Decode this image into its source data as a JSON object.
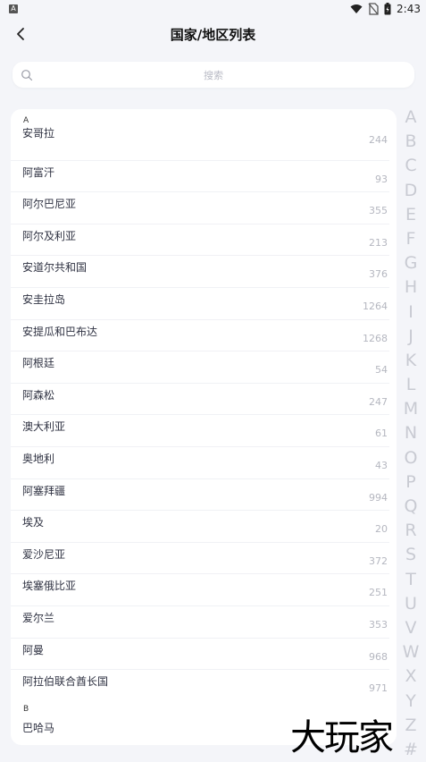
{
  "status_bar": {
    "app_icon_letter": "A",
    "time": "2:43"
  },
  "header": {
    "title": "国家/地区列表"
  },
  "search": {
    "placeholder": "搜索"
  },
  "sections": [
    {
      "letter": "A",
      "items": [
        {
          "name": "安哥拉",
          "code": "244"
        },
        {
          "name": "阿富汗",
          "code": "93"
        },
        {
          "name": "阿尔巴尼亚",
          "code": "355"
        },
        {
          "name": "阿尔及利亚",
          "code": "213"
        },
        {
          "name": "安道尔共和国",
          "code": "376"
        },
        {
          "name": "安圭拉岛",
          "code": "1264"
        },
        {
          "name": "安提瓜和巴布达",
          "code": "1268"
        },
        {
          "name": "阿根廷",
          "code": "54"
        },
        {
          "name": "阿森松",
          "code": "247"
        },
        {
          "name": "澳大利亚",
          "code": "61"
        },
        {
          "name": "奥地利",
          "code": "43"
        },
        {
          "name": "阿塞拜疆",
          "code": "994"
        },
        {
          "name": "埃及",
          "code": "20"
        },
        {
          "name": "爱沙尼亚",
          "code": "372"
        },
        {
          "name": "埃塞俄比亚",
          "code": "251"
        },
        {
          "name": "爱尔兰",
          "code": "353"
        },
        {
          "name": "阿曼",
          "code": "968"
        },
        {
          "name": "阿拉伯联合酋长国",
          "code": "971"
        }
      ]
    },
    {
      "letter": "B",
      "items": [
        {
          "name": "巴哈马",
          "code": ""
        }
      ]
    }
  ],
  "index_letters": [
    "A",
    "B",
    "C",
    "D",
    "E",
    "F",
    "G",
    "H",
    "I",
    "J",
    "K",
    "L",
    "M",
    "N",
    "O",
    "P",
    "Q",
    "R",
    "S",
    "T",
    "U",
    "V",
    "W",
    "X",
    "Y",
    "Z",
    "#"
  ],
  "watermark": "大玩家",
  "colors": {
    "background": "#f4f5f9",
    "card": "#ffffff",
    "index_letter": "#c8cad2",
    "code_text": "#b5b7c0"
  }
}
